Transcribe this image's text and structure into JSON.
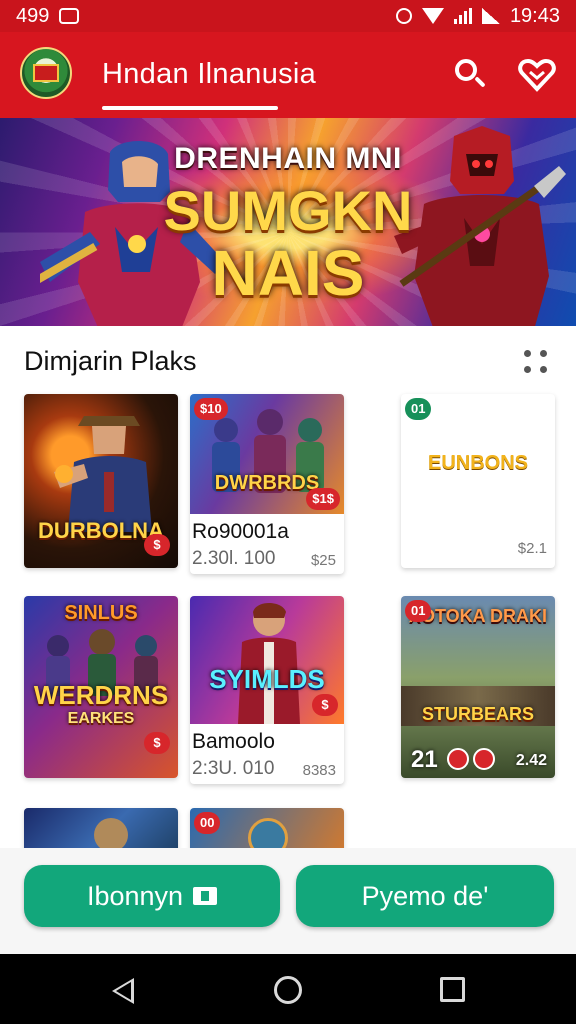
{
  "status_bar": {
    "left_text": "499",
    "time": "19:43"
  },
  "app_bar": {
    "title": "Hndan Ilnanusia",
    "icons": [
      "app-logo",
      "search-icon",
      "heart-icon"
    ]
  },
  "hero": {
    "line1": "DRENHAIN MNI",
    "line2": "SUMGKN",
    "line3": "NAIS"
  },
  "section": {
    "title": "Dimjarin Plaks"
  },
  "cards": [
    {
      "art_title": "DURBOLNA",
      "badge": "",
      "name": "",
      "stat": "",
      "price": ""
    },
    {
      "art_title": "DWRBRDS",
      "badge": "$10",
      "badge2": "$1$",
      "name": "Ro90001a",
      "stat": "2.30l. 100",
      "price": "$25"
    },
    {
      "art_title": "EUNBONS",
      "badge": "01",
      "name": "",
      "stat": "",
      "price": "$2.1"
    },
    {
      "art_title": "WERDRNS",
      "art_sub": "EARKES",
      "top_text": "SINLUS",
      "name": "",
      "stat": "",
      "price": ""
    },
    {
      "art_title": "SYIMLDS",
      "name": "Bamoolo",
      "stat": "2:3U. 010",
      "price": "8383"
    },
    {
      "art_title": "XOTOKA DRAKI",
      "art_sub": "STURBEARS",
      "badge": "01",
      "overlay_left": "21",
      "overlay_right": "2.42",
      "name": "",
      "stat": "",
      "price": ""
    },
    {
      "art_title": "",
      "name": "",
      "stat": "",
      "price": ""
    },
    {
      "art_title": "",
      "badge": "00",
      "name": "",
      "stat": "",
      "price": ""
    }
  ],
  "actions": {
    "left_label": "Ibonnyn",
    "right_label": "Pyemo de'"
  }
}
